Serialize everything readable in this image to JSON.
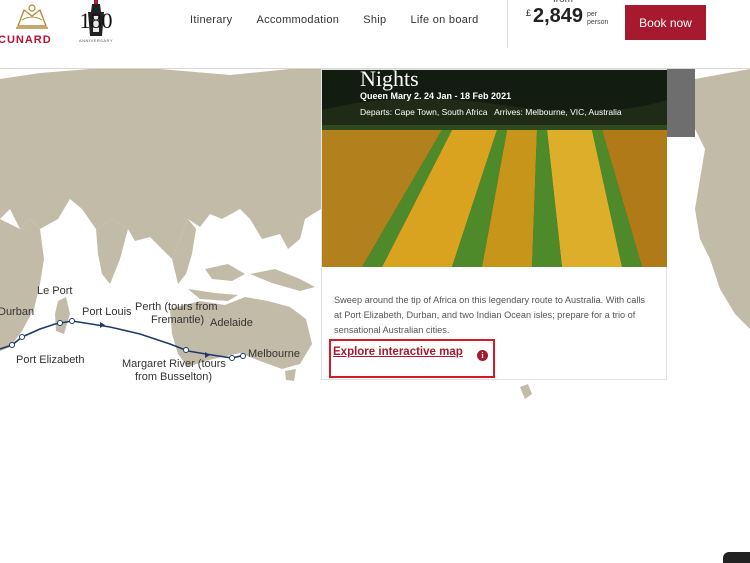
{
  "brand": {
    "name": "CUNARD",
    "anniversary": "180",
    "anniversary_sub": "ANNIVERSARY"
  },
  "nav": {
    "items": [
      "Itinerary",
      "Accommodation",
      "Ship",
      "Life on board"
    ]
  },
  "price": {
    "from": "from",
    "currency": "£",
    "amount": "2,849",
    "per_person": "per person"
  },
  "book_label": "Book now",
  "card": {
    "title": "Nights",
    "ship_dates": "Queen Mary 2.  24 Jan - 18 Feb 2021",
    "departs_label": "Departs:",
    "departs": "Cape Town, South Africa",
    "arrives_label": "Arrives:",
    "arrives": "Melbourne, VIC, Australia",
    "description": "Sweep around the tip of Africa on this legendary route to Australia. With calls at Port Elizabeth, Durban, and two Indian Ocean isles; prepare for a trio of sensational Australian cities.",
    "explore_label": "Explore interactive map",
    "info_icon": "info-icon"
  },
  "map": {
    "labels": {
      "durban": "Durban",
      "le_port": "Le Port",
      "port_louis": "Port Louis",
      "perth_1": "Perth (tours from",
      "perth_2": "Fremantle)",
      "adelaide": "Adelaide",
      "melbourne": "Melbourne",
      "port_elizabeth": "Port Elizabeth",
      "margaret_1": "Margaret River (tours",
      "margaret_2": "from Busselton)"
    }
  },
  "colors": {
    "accent": "#a6192e",
    "land": "#c2bba7",
    "route": "#1e3a6d",
    "highlight": "#d31b2a"
  }
}
